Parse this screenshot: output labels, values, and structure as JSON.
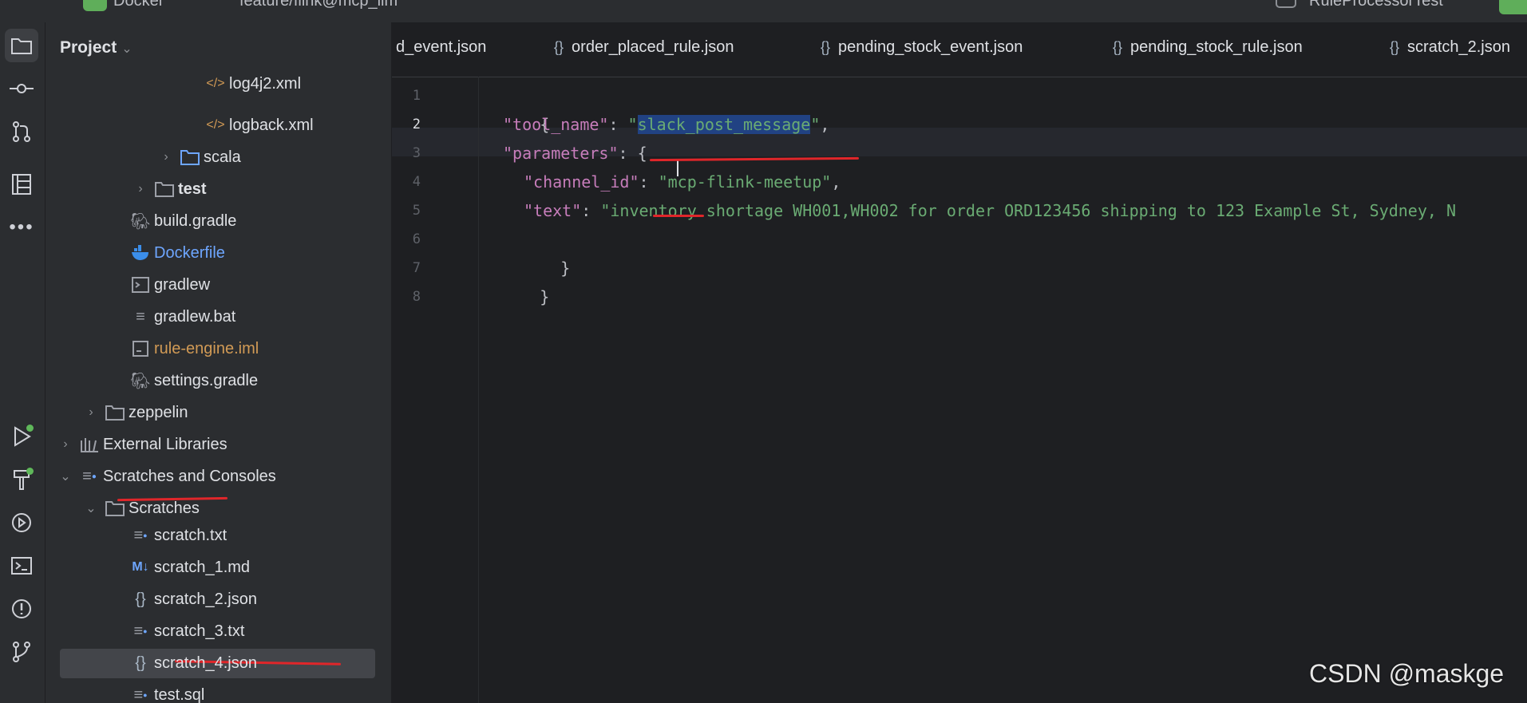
{
  "topbar": {
    "project_name": "Docker",
    "branch": "feature/flink@mcp_llm",
    "run_config": "RuleProcessorTest"
  },
  "sidebar": {
    "header": "Project",
    "items": [
      {
        "label": "log4j2.xml"
      },
      {
        "label": "logback.xml"
      },
      {
        "label": "scala"
      },
      {
        "label": "test"
      },
      {
        "label": "build.gradle"
      },
      {
        "label": "Dockerfile"
      },
      {
        "label": "gradlew"
      },
      {
        "label": "gradlew.bat"
      },
      {
        "label": "rule-engine.iml"
      },
      {
        "label": "settings.gradle"
      },
      {
        "label": "zeppelin"
      },
      {
        "label": "External Libraries"
      },
      {
        "label": "Scratches and Consoles"
      },
      {
        "label": "Scratches"
      },
      {
        "label": "scratch.txt"
      },
      {
        "label": "scratch_1.md"
      },
      {
        "label": "scratch_2.json"
      },
      {
        "label": "scratch_3.txt"
      },
      {
        "label": "scratch_4.json"
      },
      {
        "label": "test.sql"
      }
    ]
  },
  "tabs": [
    {
      "label": "d_event.json"
    },
    {
      "label": "order_placed_rule.json"
    },
    {
      "label": "pending_stock_event.json"
    },
    {
      "label": "pending_stock_rule.json"
    },
    {
      "label": "scratch_2.json"
    }
  ],
  "editor": {
    "line_numbers": [
      "1",
      "2",
      "3",
      "4",
      "5",
      "6",
      "7",
      "8"
    ],
    "current_line": 2,
    "code": {
      "l1": "{",
      "l2_key": "\"tool_name\"",
      "l2_colon": ": ",
      "l2_q1": "\"",
      "l2_value": "slack_post_message",
      "l2_q2": "\"",
      "l2_end": ",",
      "l3_key": "\"parameters\"",
      "l3_rest": ": {",
      "l4_key": "\"channel_id\"",
      "l4_colon": ": ",
      "l4_value": "\"mcp-flink-meetup\"",
      "l4_end": ",",
      "l5_key": "\"text\"",
      "l5_colon": ": ",
      "l5_value": "\"inventory shortage WH001,WH002 for order ORD123456 shipping to 123 Example St, Sydney, N",
      "l6": "}",
      "l7": "}"
    }
  },
  "watermark": "CSDN @maskge",
  "colors": {
    "sidebar_bg": "#2b2d30",
    "editor_bg": "#1e1f22",
    "json_key": "#c77dbb",
    "json_string": "#6aab73",
    "selection": "#214283",
    "annotation_red": "#e0262a"
  }
}
